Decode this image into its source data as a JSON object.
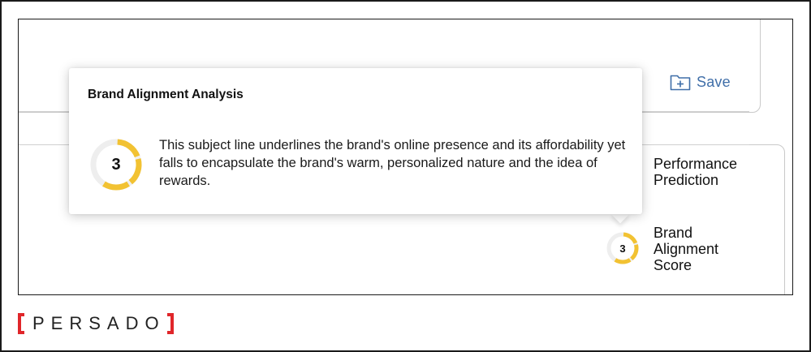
{
  "toolbar": {
    "save_label": "Save",
    "save_icon": "folder-plus-icon",
    "accent_color": "#3f6ea8"
  },
  "metrics": {
    "performance_label": "Performance\nPrediction",
    "brand_label": "Brand\nAlignment\nScore",
    "brand_score": "3",
    "brand_score_fraction": 0.6,
    "gauge_color": "#f2c232",
    "gauge_track_color": "#eeeeee"
  },
  "popover": {
    "title": "Brand Alignment Analysis",
    "score": "3",
    "text": "This subject line underlines the brand's online presence and its affordability yet falls to encapsulate the brand's warm, personalized nature and the idea of rewards."
  },
  "brand": {
    "logo_text": "PERSADO",
    "bracket_color": "#e0262a"
  }
}
